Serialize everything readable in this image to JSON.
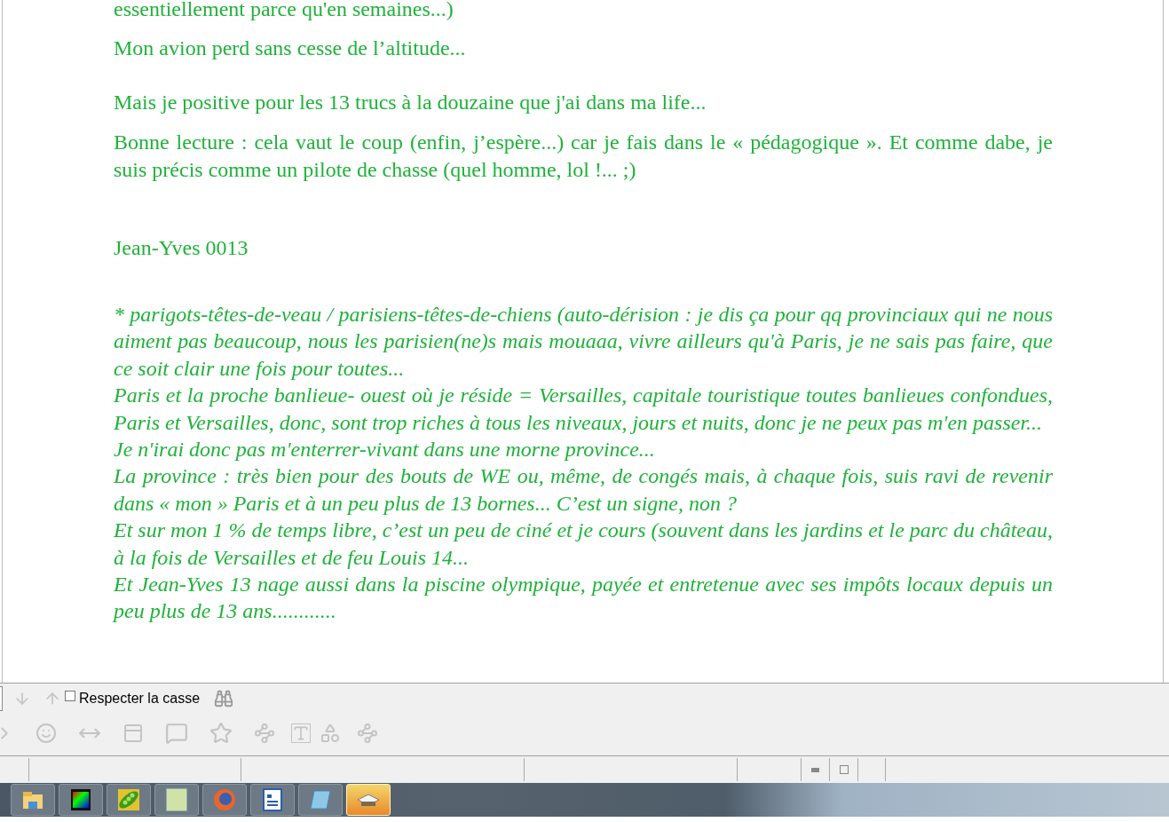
{
  "document": {
    "paragraphs": [
      {
        "kind": "body",
        "text": "essentiellement parce qu'en semaines...)"
      },
      {
        "kind": "body",
        "text": "Mon avion perd sans cesse  de l’altitude..."
      },
      {
        "kind": "body",
        "text": "Mais je positive pour les 13 trucs à la douzaine que j'ai dans ma life..."
      },
      {
        "kind": "body",
        "text": "Bonne lecture :  cela vaut le coup (enfin, j’espère...) car je fais dans le « pédagogique ». Et comme dabe,  je suis précis comme un pilote de chasse (quel homme, lol !... ;)"
      },
      {
        "kind": "body",
        "text": "Jean-Yves 0013"
      },
      {
        "kind": "note",
        "text": "* parigots-têtes-de-veau / parisiens-têtes-de-chiens (auto-dérision : je dis ça pour qq provinciaux qui ne nous aiment pas beaucoup, nous les parisien(ne)s mais mouaaa, vivre ailleurs qu'à Paris, je ne sais pas faire, que ce soit clair une fois pour toutes..."
      },
      {
        "kind": "note",
        "text": "Paris et la proche banlieue- ouest où je réside = Versailles, capitale touristique toutes banlieues confondues, Paris et Versailles, donc, sont trop riches à tous les niveaux, jours et nuits, donc je ne peux pas m'en passer..."
      },
      {
        "kind": "note",
        "text": "Je n'irai donc pas m'enterrer-vivant dans une morne province..."
      },
      {
        "kind": "note",
        "text": "La province : très bien pour des bouts de WE ou, même, de congés mais, à chaque fois, suis ravi de revenir dans « mon » Paris et à un peu plus de 13 bornes... C’est un signe, non ?"
      },
      {
        "kind": "note",
        "text": "Et sur mon 1 % de temps libre, c’est un peu de ciné et je cours (souvent dans les jardins et le parc du château, à la fois de Versailles et de feu Louis 14..."
      },
      {
        "kind": "note",
        "text": "Et Jean-Yves 13 nage aussi dans la piscine olympique, payée et entretenue avec ses impôts locaux depuis un peu plus de 13 ans............"
      }
    ]
  },
  "find_bar": {
    "match_case": {
      "label": "Respecter la casse",
      "checked": false
    }
  },
  "taskbar": {
    "items": [
      {
        "kind": "folder",
        "selected": false
      },
      {
        "kind": "film",
        "selected": false
      },
      {
        "kind": "pod",
        "selected": false
      },
      {
        "kind": "photo",
        "selected": false
      },
      {
        "kind": "browser",
        "selected": false
      },
      {
        "kind": "writer",
        "selected": false
      },
      {
        "kind": "notepad",
        "selected": false
      },
      {
        "kind": "tray",
        "selected": true
      }
    ]
  }
}
